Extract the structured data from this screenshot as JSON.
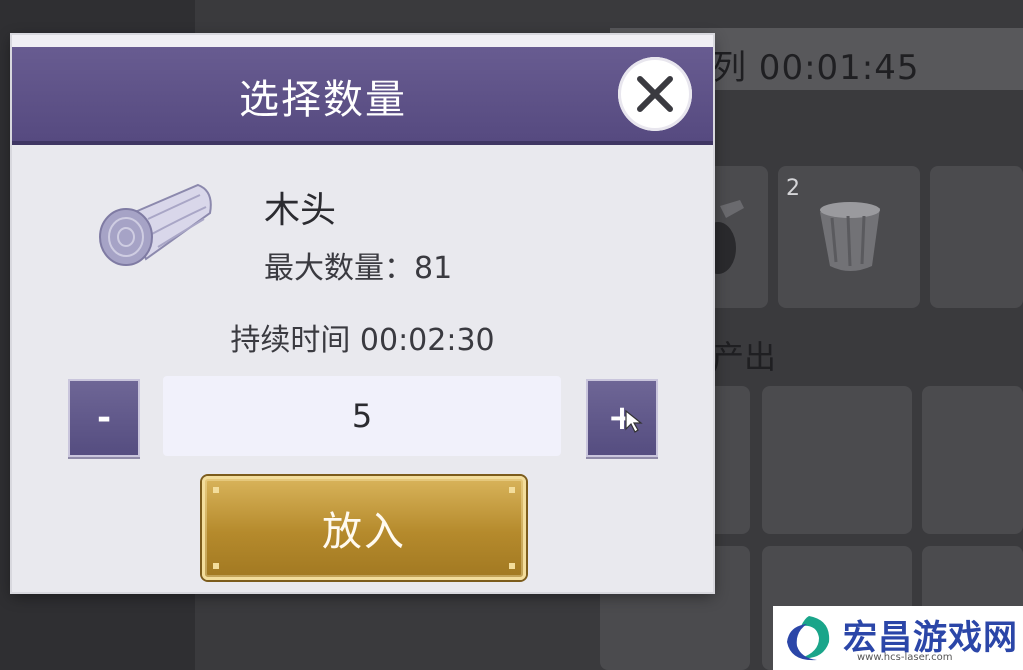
{
  "background": {
    "queue_label": "列 00:01:45",
    "slot_count": "2",
    "output_label": "产出"
  },
  "dialog": {
    "title": "选择数量",
    "item": {
      "name": "木头",
      "icon": "log-icon",
      "max_quantity_text": "最大数量：81"
    },
    "duration_text": "持续时间 00:02:30",
    "quantity": {
      "minus_label": "-",
      "plus_label": "+",
      "value": "5"
    },
    "confirm_label": "放入",
    "colors": {
      "header": "#5e5289",
      "button_gold": "#b58a2c",
      "stepper": "#625a8b"
    }
  },
  "watermark": {
    "text": "宏昌游戏网",
    "url": "www.hcs-laser.com"
  }
}
